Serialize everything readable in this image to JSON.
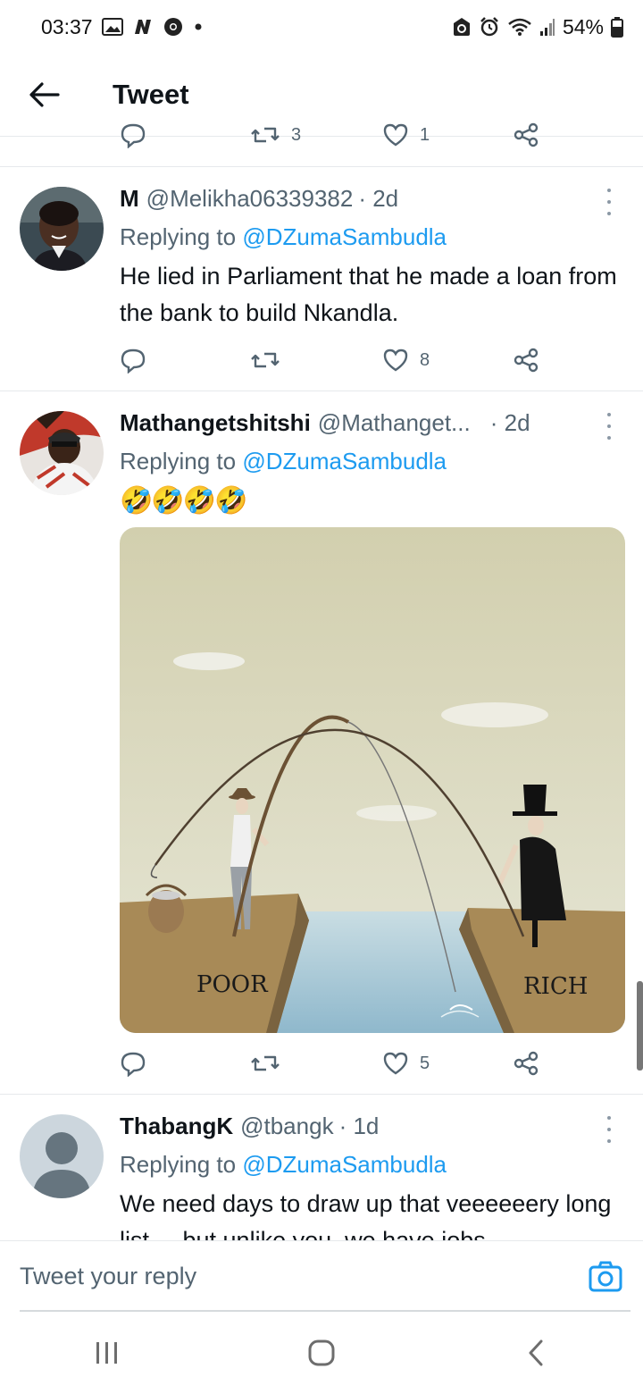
{
  "status_bar": {
    "time": "03:37",
    "battery": "54%",
    "icons_left": [
      "gallery-icon",
      "n-icon",
      "chrome-icon",
      "dot-icon"
    ],
    "icons_right": [
      "sync-icon",
      "alarm-icon",
      "wifi-icon",
      "signal-icon",
      "battery-icon"
    ]
  },
  "header": {
    "title": "Tweet",
    "back_icon": "back-arrow-icon"
  },
  "tweets": [
    {
      "name": "M",
      "handle": "@Melikha06339382",
      "time": "· 2d",
      "replying_prefix": "Replying to ",
      "replying_to": "@DZumaSambudla",
      "text": "He lied in Parliament that he made a loan from the bank to build Nkandla.",
      "likes": "8"
    },
    {
      "name": "Mathangetshitshi",
      "handle": "@Mathanget...",
      "time": "· 2d",
      "replying_prefix": "Replying to ",
      "replying_to": "@DZumaSambudla",
      "text": "🤣🤣🤣🤣",
      "image_labels": {
        "left": "POOR",
        "right": "RICH"
      },
      "likes": "5"
    },
    {
      "name": "ThabangK",
      "handle": "@tbangk",
      "time": "· 1d",
      "replying_prefix": "Replying to ",
      "replying_to": "@DZumaSambudla",
      "text": "We need days to draw up that veeeeeery long list.... but unlike you, we have jobs."
    }
  ],
  "previous_tweet_actions": {
    "retweets": "3",
    "likes": "1"
  },
  "reply_bar": {
    "placeholder": "Tweet your reply",
    "camera_icon": "camera-icon"
  },
  "nav_bar": {
    "icons": [
      "recent-apps-icon",
      "home-icon",
      "back-icon"
    ]
  },
  "colors": {
    "accent": "#1d9bf0",
    "secondary_text": "#536471",
    "primary_text": "#0f1419"
  }
}
